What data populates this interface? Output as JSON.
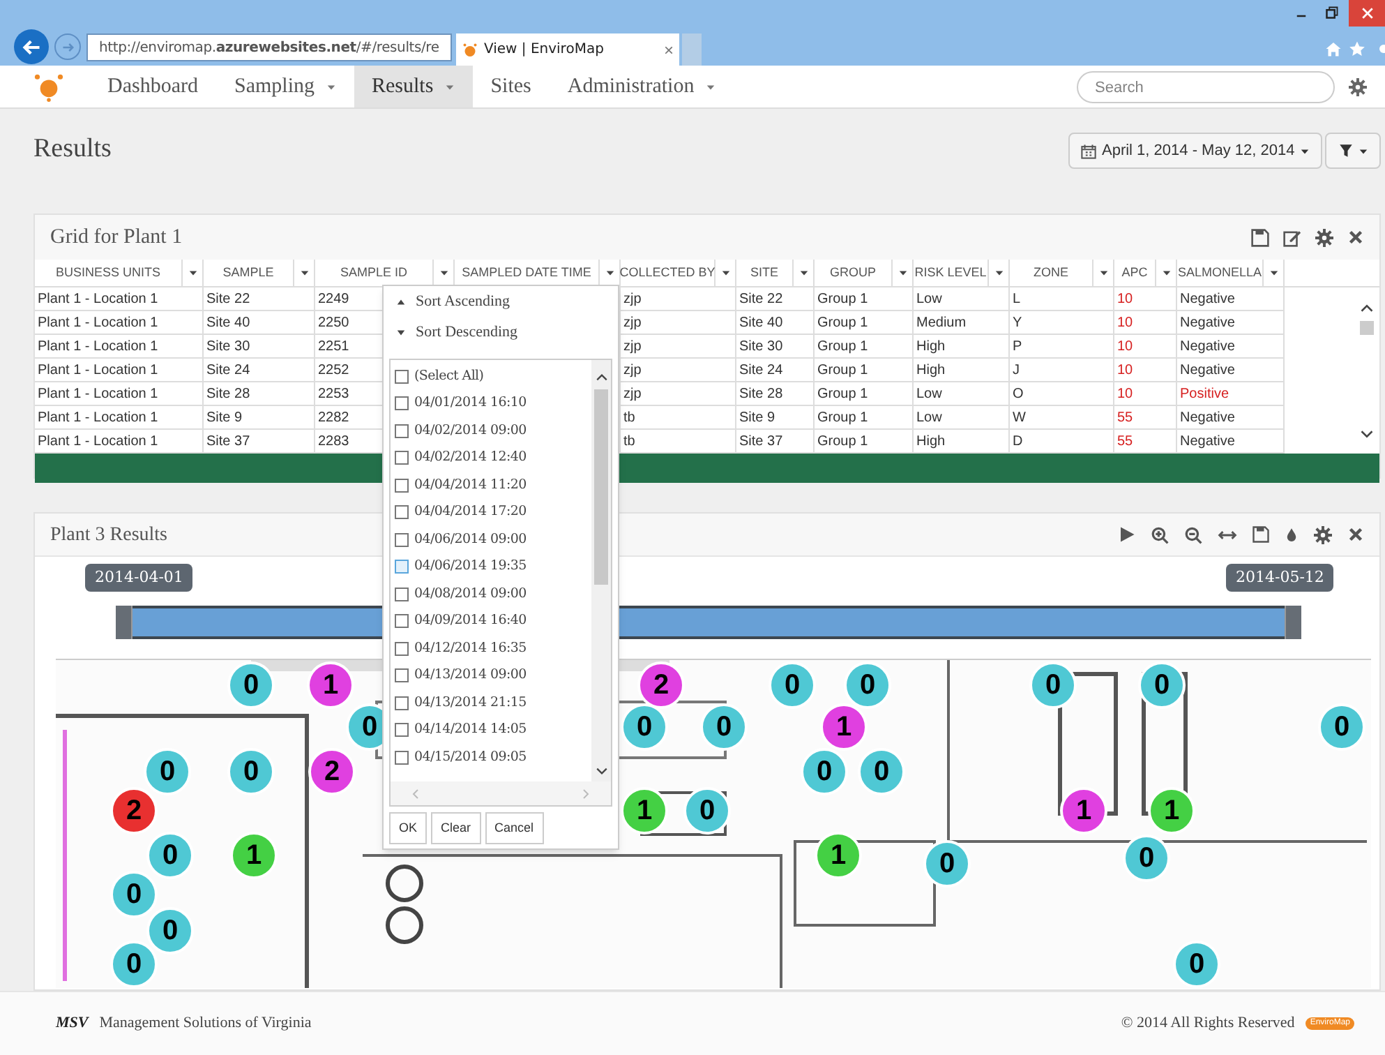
{
  "browser": {
    "address": "http://enviromap.**azurewebsites.net**/#/results/re",
    "tab_title": "View | EnviroMap",
    "tab_close": "×"
  },
  "nav": {
    "items": [
      {
        "label": "Dashboard",
        "dropdown": false,
        "selected": false
      },
      {
        "label": "Sampling",
        "dropdown": true,
        "selected": false
      },
      {
        "label": "Results",
        "dropdown": true,
        "selected": true
      },
      {
        "label": "Sites",
        "dropdown": false,
        "selected": false
      },
      {
        "label": "Administration",
        "dropdown": true,
        "selected": false
      }
    ],
    "search": {
      "placeholder": "Search"
    }
  },
  "page": {
    "title": "Results",
    "date_range": "April 1, 2014 - May 12, 2014"
  },
  "grid": {
    "title": "Grid for Plant 1",
    "columns": [
      "BUSINESS UNITS",
      "SAMPLE",
      "SAMPLE ID",
      "SAMPLED DATE TIME",
      "COLLECTED BY",
      "SITE",
      "GROUP",
      "RISK LEVEL",
      "ZONE",
      "APC",
      "SALMONELLA"
    ],
    "rows": [
      {
        "cells": [
          "Plant 1 - Location 1",
          "Site 22",
          "2249",
          "",
          "zjp",
          "Site 22",
          "Group 1",
          "Low",
          "L",
          "10",
          "Negative"
        ],
        "positive": false
      },
      {
        "cells": [
          "Plant 1 - Location 1",
          "Site 40",
          "2250",
          "",
          "zjp",
          "Site 40",
          "Group 1",
          "Medium",
          "Y",
          "10",
          "Negative"
        ],
        "positive": false
      },
      {
        "cells": [
          "Plant 1 - Location 1",
          "Site 30",
          "2251",
          "",
          "zjp",
          "Site 30",
          "Group 1",
          "High",
          "P",
          "10",
          "Negative"
        ],
        "positive": false
      },
      {
        "cells": [
          "Plant 1 - Location 1",
          "Site 24",
          "2252",
          "",
          "zjp",
          "Site 24",
          "Group 1",
          "High",
          "J",
          "10",
          "Negative"
        ],
        "positive": false
      },
      {
        "cells": [
          "Plant 1 - Location 1",
          "Site 28",
          "2253",
          "",
          "zjp",
          "Site 28",
          "Group 1",
          "Low",
          "O",
          "10",
          "Positive"
        ],
        "positive": true
      },
      {
        "cells": [
          "Plant 1 - Location 1",
          "Site 9",
          "2282",
          "",
          "tb",
          "Site 9",
          "Group 1",
          "Low",
          "W",
          "55",
          "Negative"
        ],
        "positive": false
      },
      {
        "cells": [
          "Plant 1 - Location 1",
          "Site 37",
          "2283",
          "",
          "tb",
          "Site 37",
          "Group 1",
          "High",
          "D",
          "55",
          "Negative"
        ],
        "positive": false
      }
    ]
  },
  "filter_menu": {
    "sort": [
      "Sort Ascending",
      "Sort Descending"
    ],
    "options": [
      {
        "label": "(Select All)",
        "checked": false,
        "focused": false
      },
      {
        "label": "04/01/2014 16:10",
        "checked": false,
        "focused": false
      },
      {
        "label": "04/02/2014 09:00",
        "checked": false,
        "focused": false
      },
      {
        "label": "04/02/2014 12:40",
        "checked": false,
        "focused": false
      },
      {
        "label": "04/04/2014 11:20",
        "checked": false,
        "focused": false
      },
      {
        "label": "04/04/2014 17:20",
        "checked": false,
        "focused": false
      },
      {
        "label": "04/06/2014 09:00",
        "checked": false,
        "focused": false
      },
      {
        "label": "04/06/2014 19:35",
        "checked": false,
        "focused": true
      },
      {
        "label": "04/08/2014 09:00",
        "checked": false,
        "focused": false
      },
      {
        "label": "04/09/2014 16:40",
        "checked": false,
        "focused": false
      },
      {
        "label": "04/12/2014 16:35",
        "checked": false,
        "focused": false
      },
      {
        "label": "04/13/2014 09:00",
        "checked": false,
        "focused": false
      },
      {
        "label": "04/13/2014 21:15",
        "checked": false,
        "focused": false
      },
      {
        "label": "04/14/2014 14:05",
        "checked": false,
        "focused": false
      },
      {
        "label": "04/15/2014 09:05",
        "checked": false,
        "focused": false
      }
    ],
    "buttons": [
      "OK",
      "Clear",
      "Cancel"
    ]
  },
  "map_panel": {
    "title": "Plant 3 Results",
    "timeline": {
      "start": "2014-04-01",
      "end": "2014-05-12",
      "level": 1
    },
    "markers": [
      {
        "label": "0",
        "color": "#4fc8d4"
      },
      {
        "label": "1",
        "color": "#e040e0"
      },
      {
        "label": "2",
        "color": "#e040e0"
      },
      {
        "label": "0",
        "color": "#4fc8d4"
      },
      {
        "label": "0",
        "color": "#4fc8d4"
      },
      {
        "label": "0",
        "color": "#4fc8d4"
      },
      {
        "label": "0",
        "color": "#4fc8d4"
      },
      {
        "label": "0",
        "color": "#4fc8d4"
      },
      {
        "label": "0",
        "color": "#4fc8d4"
      },
      {
        "label": "0",
        "color": "#4fc8d4"
      },
      {
        "label": "1",
        "color": "#e040e0"
      },
      {
        "label": "0",
        "color": "#4fc8d4"
      },
      {
        "label": "0",
        "color": "#4fc8d4"
      },
      {
        "label": "0",
        "color": "#4fc8d4"
      },
      {
        "label": "2",
        "color": "#e040e0"
      },
      {
        "label": "0",
        "color": "#4fc8d4"
      },
      {
        "label": "0",
        "color": "#4fc8d4"
      },
      {
        "label": "2",
        "color": "#e83030"
      },
      {
        "label": "1",
        "color": "#44d044"
      },
      {
        "label": "0",
        "color": "#4fc8d4"
      },
      {
        "label": "1",
        "color": "#e040e0"
      },
      {
        "label": "1",
        "color": "#44d044"
      },
      {
        "label": "0",
        "color": "#4fc8d4"
      },
      {
        "label": "1",
        "color": "#44d044"
      },
      {
        "label": "1",
        "color": "#44d044"
      },
      {
        "label": "0",
        "color": "#4fc8d4"
      },
      {
        "label": "0",
        "color": "#4fc8d4"
      },
      {
        "label": "0",
        "color": "#4fc8d4"
      },
      {
        "label": "0",
        "color": "#4fc8d4"
      },
      {
        "label": "0",
        "color": "#4fc8d4"
      },
      {
        "label": "0",
        "color": "#4fc8d4"
      }
    ]
  },
  "footer": {
    "logo": "MSV",
    "company": "Management Solutions of Virginia",
    "copyright": "© 2014 All Rights Reserved",
    "product_logo": "EnviroMap"
  }
}
